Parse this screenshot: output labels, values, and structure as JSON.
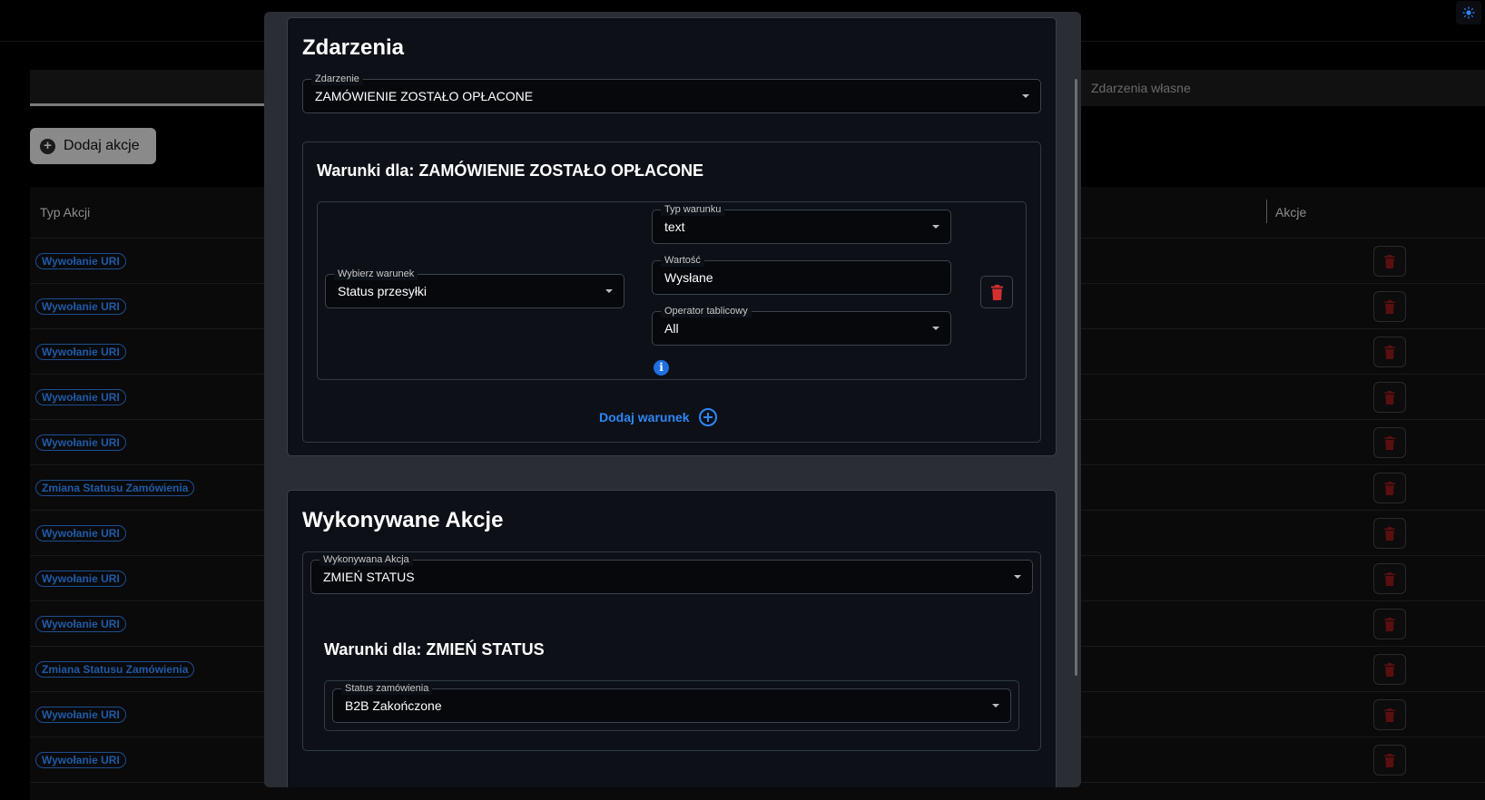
{
  "background": {
    "tabs": {
      "custom_events_label": "Zdarzenia własne"
    },
    "add_action_button": "Dodaj akcje",
    "table": {
      "col_type": "Typ Akcji",
      "col_actions": "Akcje",
      "rows": [
        "Wywołanie URI",
        "Wywołanie URI",
        "Wywołanie URI",
        "Wywołanie URI",
        "Wywołanie URI",
        "Zmiana Statusu Zamówienia",
        "Wywołanie URI",
        "Wywołanie URI",
        "Wywołanie URI",
        "Zmiana Statusu Zamówienia",
        "Wywołanie URI",
        "Wywołanie URI"
      ]
    }
  },
  "modal": {
    "events_section": {
      "title": "Zdarzenia",
      "event_field": {
        "label": "Zdarzenie",
        "value": "ZAMÓWIENIE ZOSTAŁO OPŁACONE"
      },
      "conditions": {
        "title": "Warunki dla: ZAMÓWIENIE ZOSTAŁO OPŁACONE",
        "select_condition": {
          "label": "Wybierz warunek",
          "value": "Status przesyłki"
        },
        "condition_type": {
          "label": "Typ warunku",
          "value": "text"
        },
        "value_field": {
          "label": "Wartość",
          "value": "Wysłane"
        },
        "array_operator": {
          "label": "Operator tablicowy",
          "value": "All"
        },
        "info_glyph": "i",
        "add_condition": "Dodaj warunek"
      }
    },
    "actions_section": {
      "title": "Wykonywane Akcje",
      "action_field": {
        "label": "Wykonywana Akcja",
        "value": "ZMIEŃ STATUS"
      },
      "conditions": {
        "title": "Warunki dla: ZMIEŃ STATUS",
        "order_status": {
          "label": "Status zamówienia",
          "value": "B2B Zakończone"
        }
      }
    }
  },
  "colors": {
    "accent_blue": "#2f86f6",
    "delete_red": "#d32f2f",
    "chip_blue": "#1f5aa8"
  }
}
